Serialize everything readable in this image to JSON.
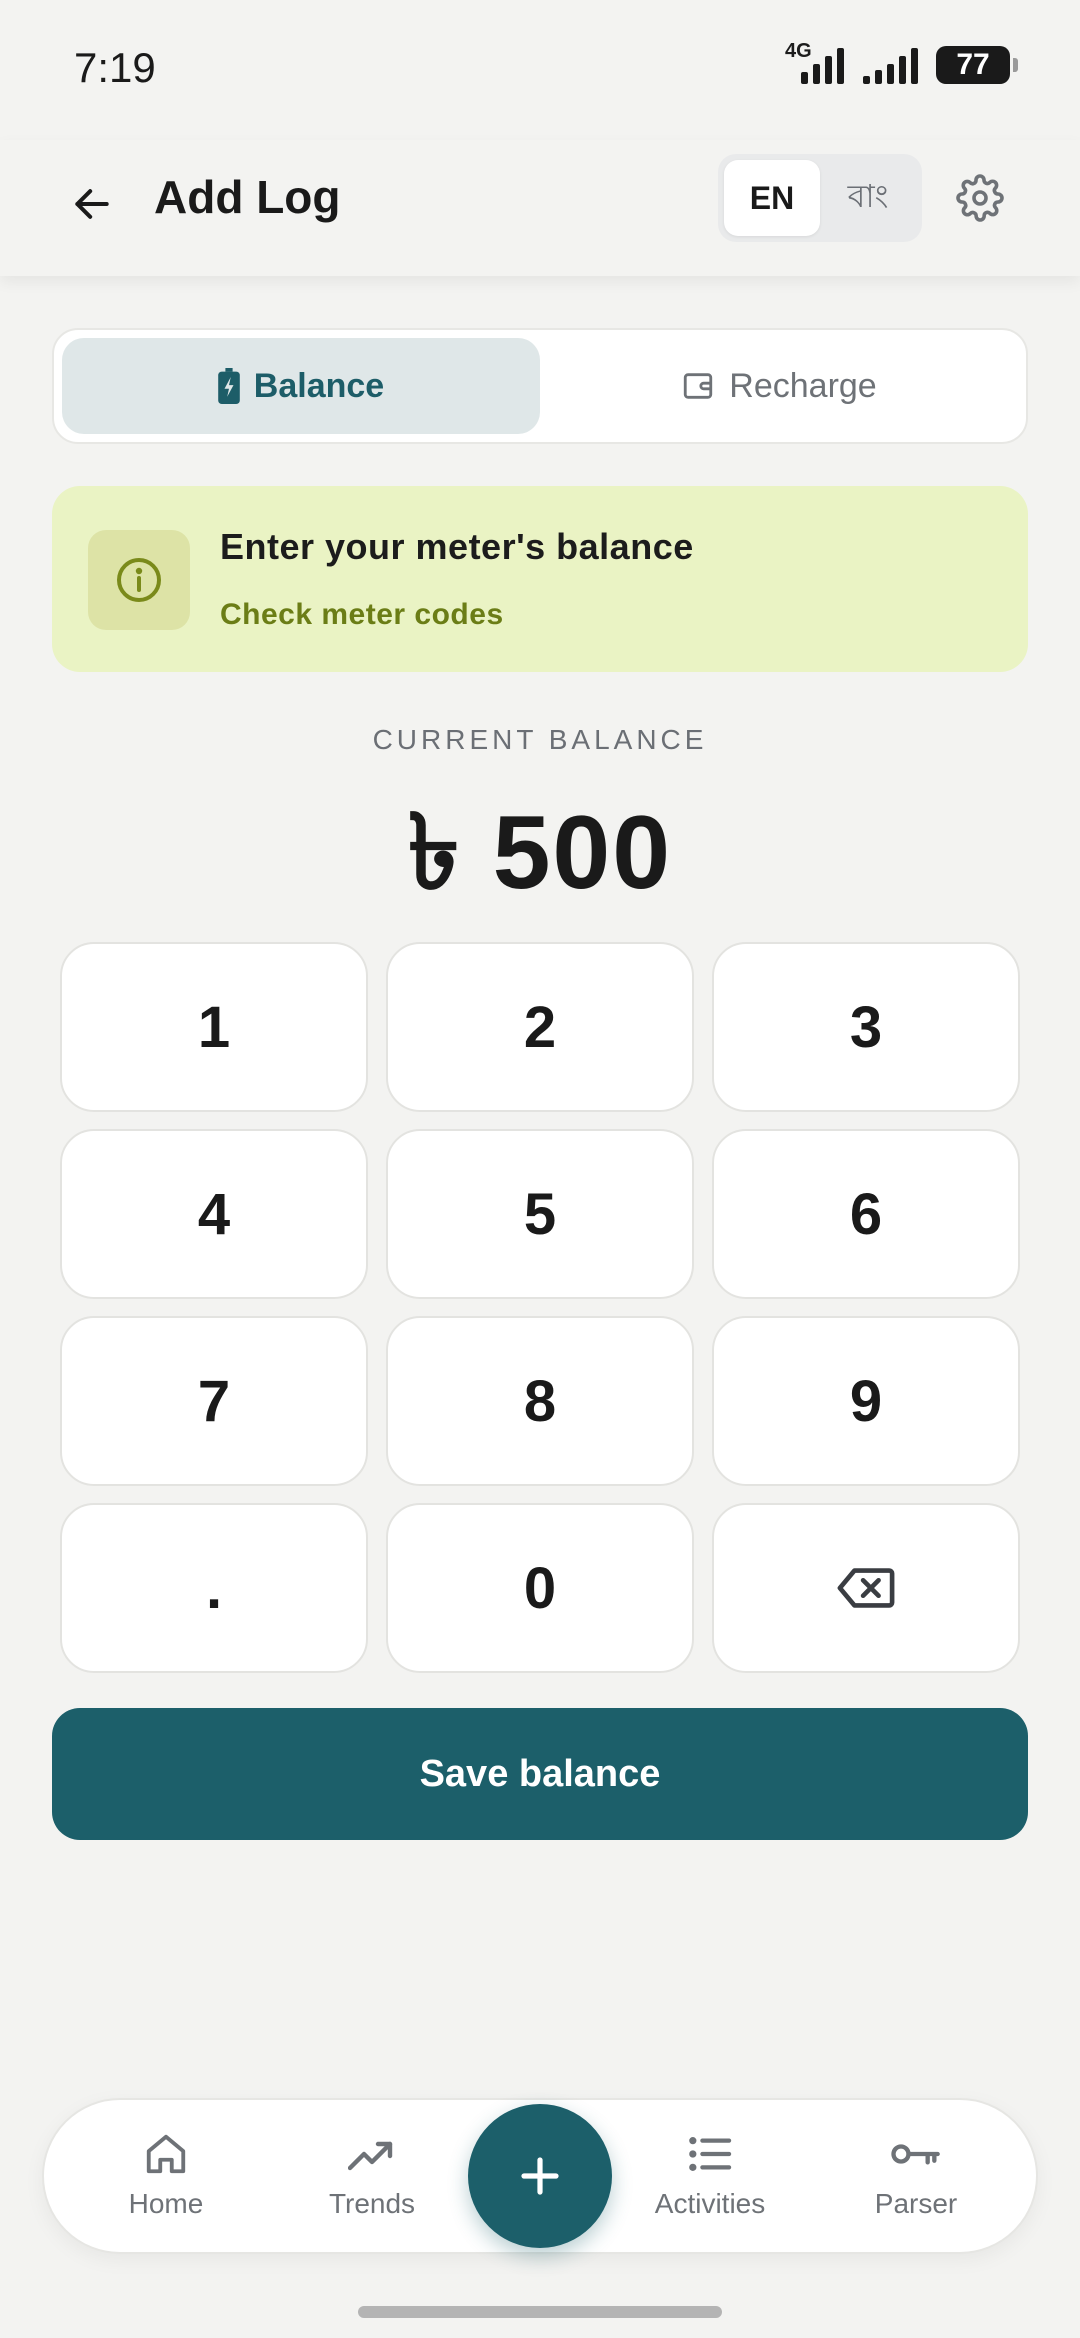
{
  "status_bar": {
    "time": "7:19",
    "network": "4G",
    "battery": "77"
  },
  "header": {
    "title": "Add Log",
    "lang_en": "EN",
    "lang_bn": "বাং",
    "active_lang": "EN"
  },
  "tabs": {
    "balance_label": "Balance",
    "recharge_label": "Recharge",
    "active": "Balance"
  },
  "info_banner": {
    "title": "Enter your meter's balance",
    "link": "Check meter codes"
  },
  "balance": {
    "label": "CURRENT BALANCE",
    "value": "৳ 500"
  },
  "keypad": {
    "keys": [
      "1",
      "2",
      "3",
      "4",
      "5",
      "6",
      "7",
      "8",
      "9",
      ".",
      "0"
    ]
  },
  "save_button": "Save balance",
  "bottom_nav": {
    "home": "Home",
    "trends": "Trends",
    "activities": "Activities",
    "parser": "Parser"
  },
  "colors": {
    "accent": "#1c5f6a",
    "banner_bg": "#eaf3c4",
    "banner_link": "#6b7d16",
    "active_tab_bg": "#dfe7e8"
  }
}
